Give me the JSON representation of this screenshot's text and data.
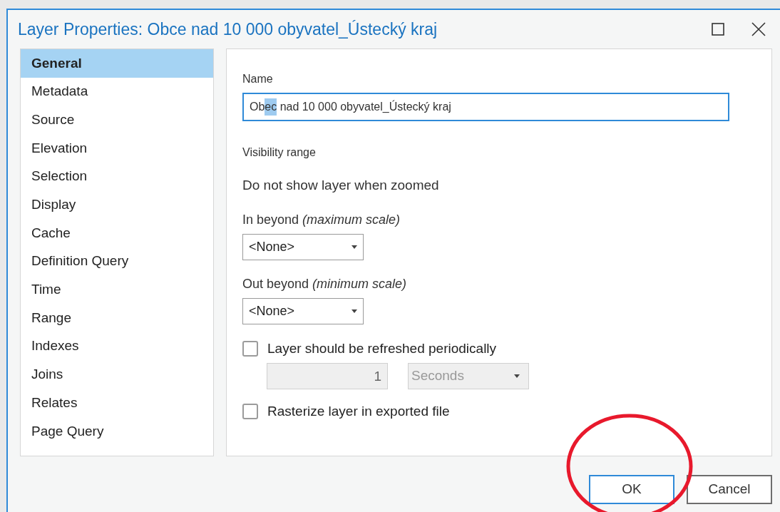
{
  "window": {
    "title": "Layer Properties: Obce nad 10 000 obyvatel_Ústecký kraj"
  },
  "sidebar": {
    "items": [
      {
        "label": "General",
        "selected": true
      },
      {
        "label": "Metadata",
        "selected": false
      },
      {
        "label": "Source",
        "selected": false
      },
      {
        "label": "Elevation",
        "selected": false
      },
      {
        "label": "Selection",
        "selected": false
      },
      {
        "label": "Display",
        "selected": false
      },
      {
        "label": "Cache",
        "selected": false
      },
      {
        "label": "Definition Query",
        "selected": false
      },
      {
        "label": "Time",
        "selected": false
      },
      {
        "label": "Range",
        "selected": false
      },
      {
        "label": "Indexes",
        "selected": false
      },
      {
        "label": "Joins",
        "selected": false
      },
      {
        "label": "Relates",
        "selected": false
      },
      {
        "label": "Page Query",
        "selected": false
      }
    ]
  },
  "general": {
    "name_label": "Name",
    "name_value": [
      {
        "text": "Ob",
        "selected": false
      },
      {
        "text": "ec",
        "selected": true
      },
      {
        "text": " nad 10 000 obyvatel_Ústecký kraj",
        "selected": false
      }
    ],
    "visibility_heading": "Visibility range",
    "visibility_note": "Do not show layer when zoomed",
    "in_beyond": {
      "label": "In beyond *(maximum scale)*",
      "value": "<None>"
    },
    "out_beyond": {
      "label": "Out beyond *(minimum scale)*",
      "value": "<None>"
    },
    "refresh": {
      "label": "Layer should be refreshed periodically",
      "checked": false,
      "interval": "1",
      "unit": "Seconds",
      "disabled": true
    },
    "rasterize": {
      "label": "Rasterize layer in exported file",
      "checked": false
    }
  },
  "buttons": [
    {
      "label": "OK",
      "selected": true
    },
    {
      "label": "Cancel",
      "selected": false
    }
  ],
  "annotation": {
    "kind": "circle",
    "color": "#e8192c"
  }
}
